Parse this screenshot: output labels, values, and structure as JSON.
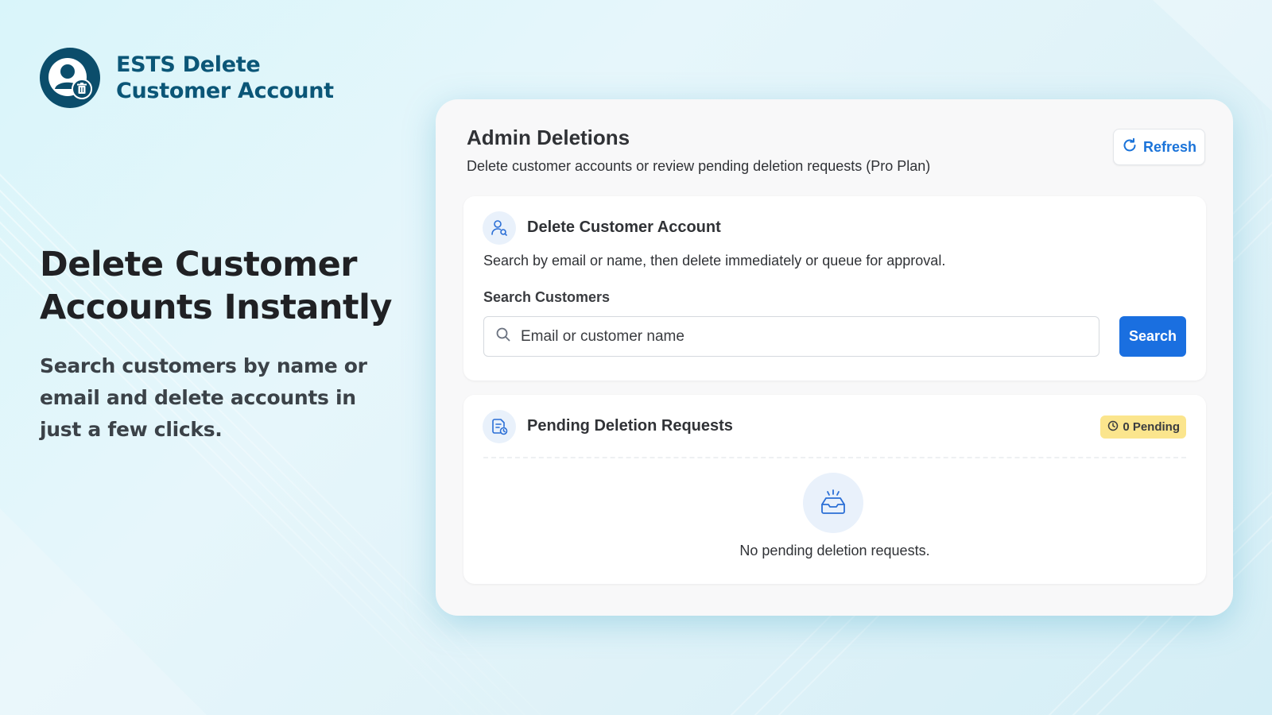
{
  "brand": {
    "title_line1": "ESTS Delete",
    "title_line2": "Customer Account",
    "logo_icon": "user-trash-icon"
  },
  "hero": {
    "title_line1": "Delete Customer",
    "title_line2": "Accounts Instantly",
    "subtitle_line1": "Search customers by name or",
    "subtitle_line2": "email and delete accounts in",
    "subtitle_line3": "just a few clicks."
  },
  "panel": {
    "title": "Admin Deletions",
    "subtitle": "Delete customer accounts or review pending deletion requests (Pro Plan)",
    "refresh_label": "Refresh"
  },
  "delete_card": {
    "title": "Delete Customer Account",
    "description": "Search by email or name, then delete immediately or queue for approval.",
    "field_label": "Search Customers",
    "search_placeholder": "Email or customer name",
    "search_value": "",
    "search_button": "Search"
  },
  "pending_card": {
    "title": "Pending Deletion Requests",
    "badge": "0 Pending",
    "empty_message": "No pending deletion requests."
  },
  "colors": {
    "brand_dark": "#0b4d6b",
    "primary": "#1a6fe0",
    "badge_bg": "#fbe58d"
  }
}
